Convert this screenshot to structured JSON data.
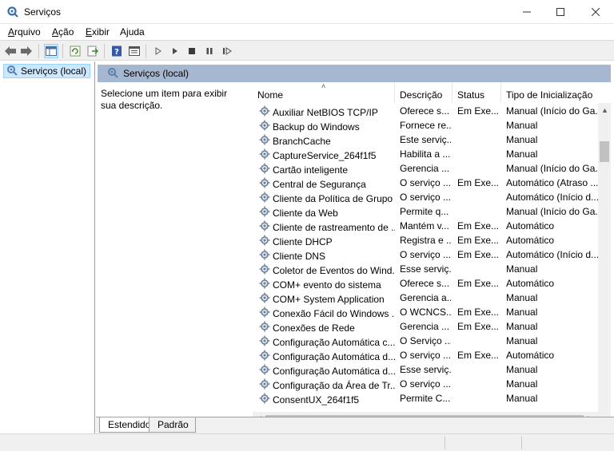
{
  "window": {
    "title": "Serviços",
    "icon": "gear-icon"
  },
  "menu": [
    {
      "label": "Arquivo",
      "accel": "A",
      "rest": "rquivo"
    },
    {
      "label": "Ação",
      "accel": "A",
      "rest": "ção"
    },
    {
      "label": "Exibir",
      "accel": "E",
      "rest": "xibir"
    },
    {
      "label": "Ajuda",
      "accel": "j",
      "pre": "A",
      "rest": "uda"
    }
  ],
  "toolbar": {
    "icons": [
      "back-arrow-icon",
      "forward-arrow-icon",
      "console-tree-icon",
      "refresh-icon",
      "export-list-icon",
      "help-icon",
      "properties-icon",
      "start-service-icon",
      "start-service-alt-icon",
      "stop-service-icon",
      "pause-service-icon",
      "resume-service-icon"
    ]
  },
  "tree": {
    "selected": "Serviços (local)"
  },
  "pane": {
    "header": "Serviços (local)",
    "description": "Selecione um item para exibir sua descrição."
  },
  "columns": {
    "name": "Nome",
    "description": "Descrição",
    "status": "Status",
    "startup": "Tipo de Inicialização"
  },
  "services": [
    {
      "name": "Auxiliar NetBIOS TCP/IP",
      "desc": "Oferece s...",
      "status": "Em Exe...",
      "startup": "Manual (Início do Ga..."
    },
    {
      "name": "Backup do Windows",
      "desc": "Fornece re...",
      "status": "",
      "startup": "Manual"
    },
    {
      "name": "BranchCache",
      "desc": "Este serviç...",
      "status": "",
      "startup": "Manual"
    },
    {
      "name": "CaptureService_264f1f5",
      "desc": "Habilita a ...",
      "status": "",
      "startup": "Manual"
    },
    {
      "name": "Cartão inteligente",
      "desc": "Gerencia ...",
      "status": "",
      "startup": "Manual (Início do Ga..."
    },
    {
      "name": "Central de Segurança",
      "desc": "O serviço ...",
      "status": "Em Exe...",
      "startup": "Automático (Atraso ..."
    },
    {
      "name": "Cliente da Política de Grupo",
      "desc": "O serviço ...",
      "status": "",
      "startup": "Automático (Início d..."
    },
    {
      "name": "Cliente da Web",
      "desc": "Permite q...",
      "status": "",
      "startup": "Manual (Início do Ga..."
    },
    {
      "name": "Cliente de rastreamento de ...",
      "desc": "Mantém v...",
      "status": "Em Exe...",
      "startup": "Automático"
    },
    {
      "name": "Cliente DHCP",
      "desc": "Registra e ...",
      "status": "Em Exe...",
      "startup": "Automático"
    },
    {
      "name": "Cliente DNS",
      "desc": "O serviço ...",
      "status": "Em Exe...",
      "startup": "Automático (Início d..."
    },
    {
      "name": "Coletor de Eventos do Wind...",
      "desc": "Esse serviç...",
      "status": "",
      "startup": "Manual"
    },
    {
      "name": "COM+ evento do sistema",
      "desc": "Oferece s...",
      "status": "Em Exe...",
      "startup": "Automático"
    },
    {
      "name": "COM+ System Application",
      "desc": "Gerencia a...",
      "status": "",
      "startup": "Manual"
    },
    {
      "name": "Conexão Fácil do Windows ...",
      "desc": "O WCNCS...",
      "status": "Em Exe...",
      "startup": "Manual"
    },
    {
      "name": "Conexões de Rede",
      "desc": "Gerencia ...",
      "status": "Em Exe...",
      "startup": "Manual"
    },
    {
      "name": "Configuração Automática c...",
      "desc": "O Serviço ...",
      "status": "",
      "startup": "Manual"
    },
    {
      "name": "Configuração Automática d...",
      "desc": "O serviço ...",
      "status": "Em Exe...",
      "startup": "Automático"
    },
    {
      "name": "Configuração Automática d...",
      "desc": "Esse serviç...",
      "status": "",
      "startup": "Manual"
    },
    {
      "name": "Configuração da Área de Tr...",
      "desc": "O serviço ...",
      "status": "",
      "startup": "Manual"
    },
    {
      "name": "ConsentUX_264f1f5",
      "desc": "Permite C...",
      "status": "",
      "startup": "Manual"
    }
  ],
  "tabs": [
    {
      "label": "Estendido",
      "active": true
    },
    {
      "label": "Padrão",
      "active": false
    }
  ],
  "colors": {
    "pane_header": "#a6b8cf",
    "selection": "#cce8ff"
  }
}
